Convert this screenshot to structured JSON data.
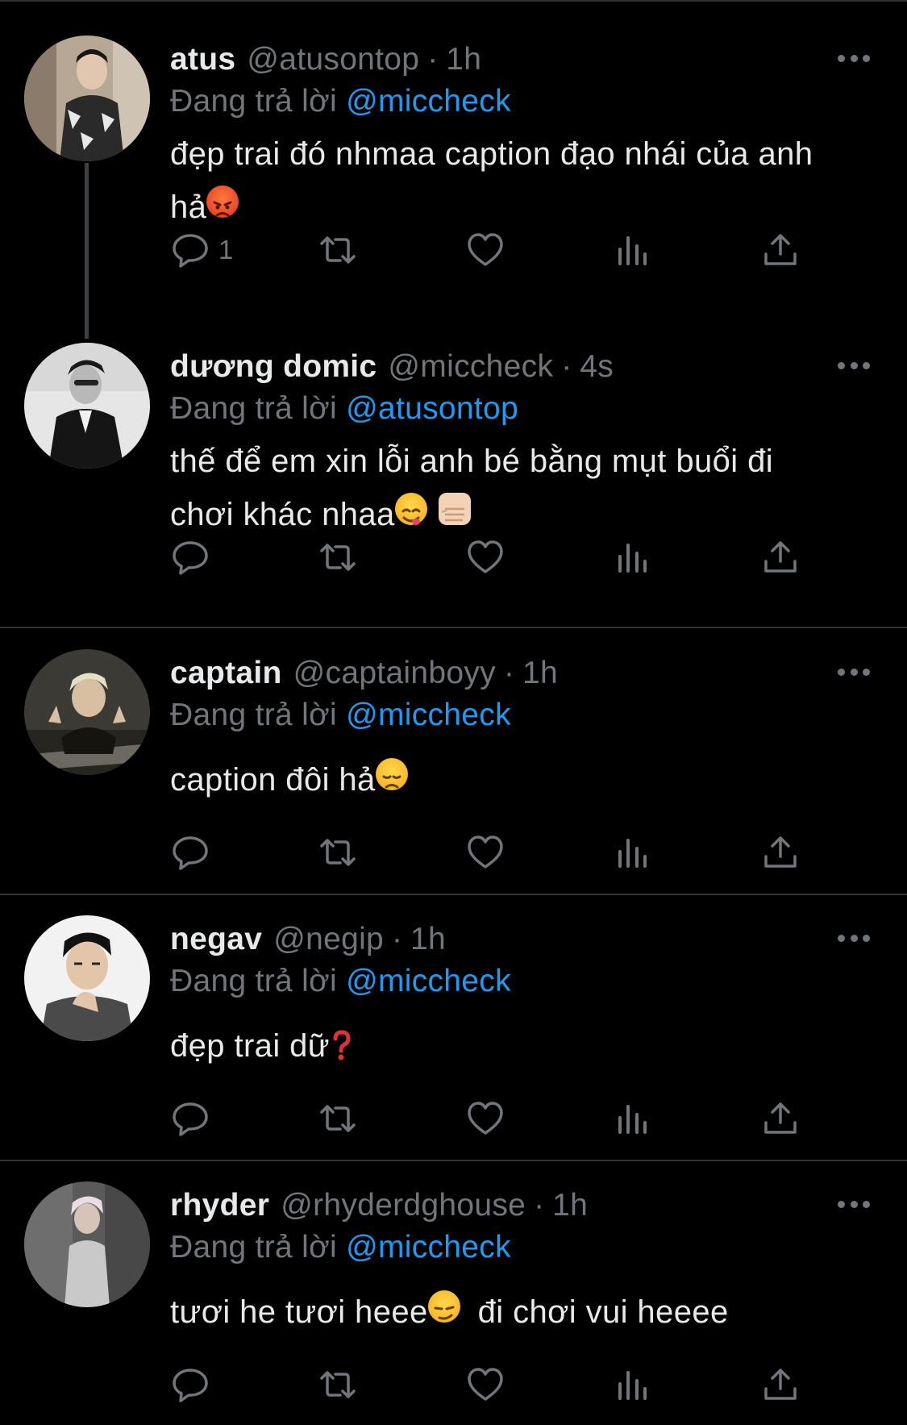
{
  "replying_prefix": "Đang trả lời",
  "icons": {
    "reply": "reply-bubble-icon",
    "retweet": "retweet-arrows-icon",
    "like": "heart-icon",
    "views": "bar-chart-icon",
    "share": "share-upload-icon",
    "more": "more-dots-icon"
  },
  "colors": {
    "mention": "#1d9bf0",
    "muted": "#71767b",
    "text": "#e7e9ea",
    "bg": "#000000"
  },
  "tweets": [
    {
      "name": "atus",
      "handle": "@atusontop",
      "dot": "·",
      "time": "1h",
      "replying_to": "@miccheck",
      "text_line1": "đẹp trai đó nhmaa caption đạo nhái của anh",
      "text_line2": "hả",
      "emoji": "angry-face-emoji",
      "reply_count": "1"
    },
    {
      "name": "dương domic",
      "handle": "@miccheck",
      "dot": "·",
      "time": "4s",
      "replying_to": "@atusontop",
      "text_line1": "thế để em xin lỗi anh bé bằng mụt buổi đi",
      "text_line2": "chơi khác nhaa",
      "emoji": "yum-face-emoji",
      "emoji2": "fist-bump-emoji"
    },
    {
      "name": "captain",
      "handle": "@captainboyy",
      "dot": "·",
      "time": "1h",
      "replying_to": "@miccheck",
      "text_line1": "caption đôi hả",
      "emoji": "disappointed-face-emoji"
    },
    {
      "name": "negav",
      "handle": "@negip",
      "dot": "·",
      "time": "1h",
      "replying_to": "@miccheck",
      "text_line1": "đẹp trai dữ",
      "emoji": "red-question-mark-emoji"
    },
    {
      "name": "rhyder",
      "handle": "@rhyderdghouse",
      "dot": "·",
      "time": "1h",
      "replying_to": "@miccheck",
      "text_line1": "tươi he tươi heee",
      "text_line1b": "đi chơi vui heeee",
      "emoji": "smirk-face-emoji"
    }
  ]
}
